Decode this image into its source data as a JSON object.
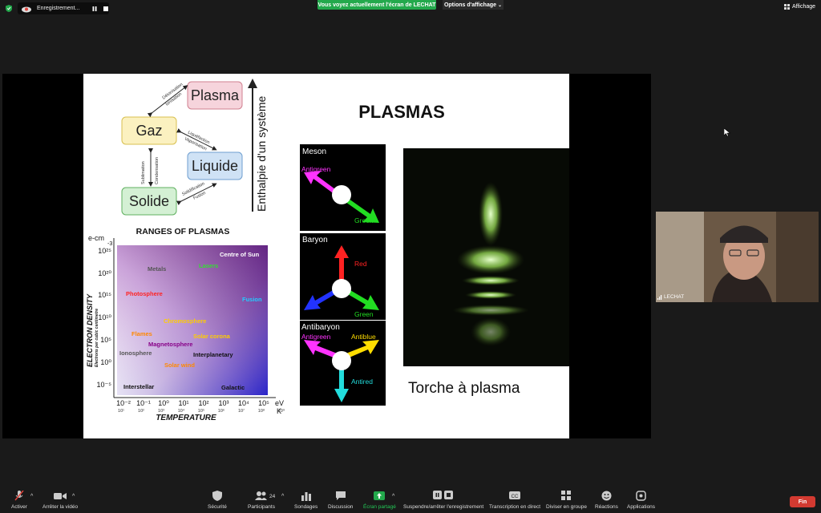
{
  "topbar": {
    "recording_label": "Enregistrement...",
    "share_banner": "Vous voyez actuellement l'écran de LECHAT",
    "view_options": "Options d'affichage",
    "view_options_caret": "⌄",
    "display_label": "Affichage"
  },
  "slide": {
    "title": "PLASMAS",
    "states": {
      "plasma": "Plasma",
      "gaz": "Gaz",
      "liquide": "Liquide",
      "solide": "Solide",
      "axis": "Enthalpie d'un système",
      "t1": "Déionisation",
      "t2": "Ionisation",
      "t3": "Liquéfaction",
      "t4": "Vaporisation",
      "t5": "Sublimation",
      "t6": "Condensation",
      "t7": "Solidification",
      "t8": "Fusion"
    },
    "ranges": {
      "title": "RANGES OF PLASMAS",
      "y_unit": "e-cm",
      "y_unit2": "-3",
      "y_label": "ELECTRON DENSITY",
      "y_sublabel": "Electrons per cubic centimetre",
      "y_ticks": [
        "10²⁵",
        "10²⁰",
        "10¹⁵",
        "10¹⁰",
        "10⁵",
        "10⁰",
        "10⁻⁵"
      ],
      "x_ticks_ev": [
        "10⁻²",
        "10⁻¹",
        "10⁰",
        "10¹",
        "10²",
        "10³",
        "10⁴",
        "10⁵"
      ],
      "x_ticks_k": [
        "10¹",
        "10²",
        "10³",
        "10⁴",
        "10⁵",
        "10⁶",
        "10⁷",
        "10⁸",
        "10⁹"
      ],
      "x_unit_ev": "eV",
      "x_unit_k": "K",
      "x_label": "TEMPERATURE",
      "regions": [
        {
          "label": "Centre of Sun",
          "color": "#ffffff"
        },
        {
          "label": "Metals",
          "color": "#555555"
        },
        {
          "label": "Lasers",
          "color": "#33dd33"
        },
        {
          "label": "Photosphere",
          "color": "#ff2222"
        },
        {
          "label": "Fusion",
          "color": "#22ccff"
        },
        {
          "label": "Chromosphere",
          "color": "#ffcc00"
        },
        {
          "label": "Flames",
          "color": "#ff8800"
        },
        {
          "label": "Solar corona",
          "color": "#ffcc00"
        },
        {
          "label": "Magnetosphere",
          "color": "#880088"
        },
        {
          "label": "Ionosphere",
          "color": "#555555"
        },
        {
          "label": "Interplanetary",
          "color": "#111111"
        },
        {
          "label": "Solar wind",
          "color": "#ff8800"
        },
        {
          "label": "Interstellar",
          "color": "#111111"
        },
        {
          "label": "Galactic",
          "color": "#111111"
        }
      ]
    },
    "panels": {
      "meson": "Meson",
      "antigreen1": "Antigreen",
      "green1": "Green",
      "baryon": "Baryon",
      "red": "Red",
      "green2": "Green",
      "antibaryon": "Antibaryon",
      "antigreen2": "Antigreen",
      "antiblue": "Antiblue",
      "antired": "Antired"
    },
    "torch_caption": "Torche à plasma"
  },
  "participant": {
    "name": "LECHAT"
  },
  "toolbar": {
    "activer": "Activer",
    "video": "Arrêter la vidéo",
    "securite": "Sécurité",
    "participants": "Participants",
    "participants_count": "24",
    "sondages": "Sondages",
    "discussion": "Discussion",
    "ecran_partage": "Écran partagé",
    "suspendre": "Suspendre/arrêter l'enregistrement",
    "transcription": "Transcription en direct",
    "diviser": "Diviser en groupe",
    "reactions": "Réactions",
    "applications": "Applications",
    "fin": "Fin"
  },
  "colors": {
    "share_green": "#23a94c",
    "end_red": "#d33a31",
    "toolbar_bg": "#1a1a1a"
  }
}
